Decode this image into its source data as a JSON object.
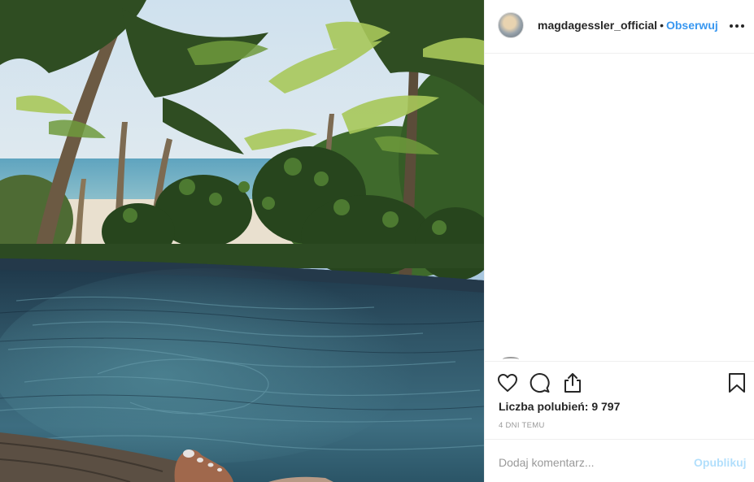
{
  "post": {
    "image_description": "photo-infinity-pool-palm-trees"
  },
  "header": {
    "username": "magdagessler_official",
    "separator": "•",
    "follow_label": "Obserwuj",
    "more_icon": "more-horizontal-icon"
  },
  "actions": {
    "like_icon": "heart-icon",
    "comment_icon": "comment-bubble-icon",
    "share_icon": "share-upload-icon",
    "save_icon": "bookmark-icon"
  },
  "likes_text": "Liczba polubień: 9 797",
  "timestamp": "4 DNI TEMU",
  "comment_box": {
    "placeholder": "Dodaj komentarz...",
    "publish_label": "Opublikuj"
  },
  "colors": {
    "accent": "#3897f0",
    "publish_disabled": "#b2dffc",
    "muted_text": "#999999"
  }
}
